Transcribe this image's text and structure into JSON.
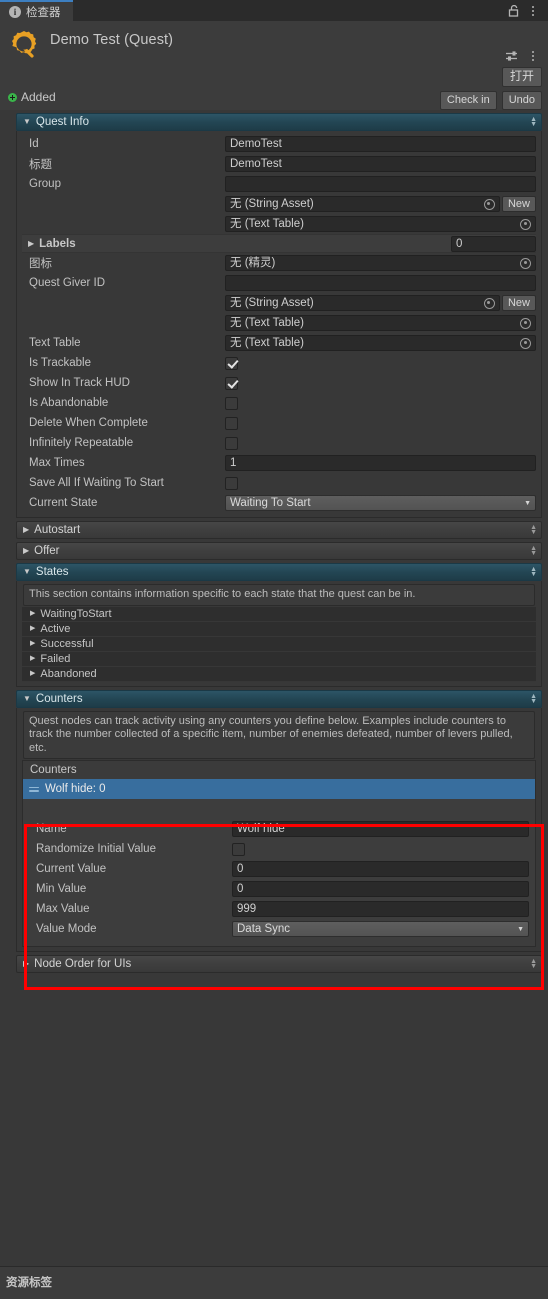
{
  "tab": {
    "label": "检查器",
    "icon": "info-icon"
  },
  "window_icons": {
    "lock": "lock-icon",
    "menu": "kebab-menu-icon",
    "preset": "preset-icon"
  },
  "object_header": {
    "icon": "quest-asset-icon",
    "title": "Demo Test (Quest)",
    "open_button": "打开",
    "status": "Added",
    "status_icon": "added-plus-icon",
    "check_in_button": "Check in",
    "undo_button": "Undo"
  },
  "quest_info": {
    "title": "Quest Info",
    "expanded": true,
    "rows": [
      {
        "label": "Id",
        "type": "text",
        "value": "DemoTest"
      },
      {
        "label": "标题",
        "type": "text",
        "value": "DemoTest"
      },
      {
        "label": "Group",
        "type": "text",
        "value": ""
      },
      {
        "label": "",
        "type": "object_new",
        "value": "无 (String Asset)",
        "new_label": "New"
      },
      {
        "label": "",
        "type": "object",
        "value": "无 (Text Table)"
      }
    ],
    "labels_array": {
      "label": "Labels",
      "size": "0",
      "expanded": false
    },
    "rows2": [
      {
        "label": "图标",
        "type": "object",
        "value": "无 (精灵)"
      },
      {
        "label": "Quest Giver ID",
        "type": "text",
        "value": ""
      },
      {
        "label": "",
        "type": "object_new",
        "value": "无 (String Asset)",
        "new_label": "New"
      },
      {
        "label": "",
        "type": "object",
        "value": "无 (Text Table)"
      },
      {
        "label": "Text Table",
        "type": "object",
        "value": "无 (Text Table)"
      },
      {
        "label": "Is Trackable",
        "type": "checkbox",
        "value": true
      },
      {
        "label": "Show In Track HUD",
        "type": "checkbox",
        "value": true
      },
      {
        "label": "Is Abandonable",
        "type": "checkbox",
        "value": false
      },
      {
        "label": "Delete When Complete",
        "type": "checkbox",
        "value": false
      },
      {
        "label": "Infinitely Repeatable",
        "type": "checkbox",
        "value": false
      },
      {
        "label": "Max Times",
        "type": "text",
        "value": "1"
      },
      {
        "label": "Save All If Waiting To Start",
        "type": "checkbox",
        "value": false
      },
      {
        "label": "Current State",
        "type": "dropdown",
        "value": "Waiting To Start"
      }
    ]
  },
  "autostart": {
    "title": "Autostart",
    "expanded": false
  },
  "offer": {
    "title": "Offer",
    "expanded": false
  },
  "states": {
    "title": "States",
    "expanded": true,
    "help": "This section contains information specific to each state that the quest can be in.",
    "items": [
      "WaitingToStart",
      "Active",
      "Successful",
      "Failed",
      "Abandoned"
    ]
  },
  "counters": {
    "title": "Counters",
    "expanded": true,
    "help": "Quest nodes can track activity using any counters you define below. Examples include counters to track the number collected of a specific item, number of enemies defeated, number of levers pulled, etc.",
    "list_header": "Counters",
    "list_items": [
      {
        "label": "Wolf hide: 0",
        "selected": true
      }
    ],
    "add_button": "+",
    "remove_button": "−",
    "detail": [
      {
        "label": "Name",
        "type": "text",
        "value": "Wolf hide"
      },
      {
        "label": "Randomize Initial Value",
        "type": "checkbox",
        "value": false
      },
      {
        "label": "Current Value",
        "type": "text",
        "value": "0"
      },
      {
        "label": "Min Value",
        "type": "text",
        "value": "0"
      },
      {
        "label": "Max Value",
        "type": "text",
        "value": "999"
      },
      {
        "label": "Value Mode",
        "type": "dropdown",
        "value": "Data Sync"
      }
    ]
  },
  "node_order": {
    "title": "Node Order for UIs",
    "expanded": false
  },
  "footer": {
    "label": "资源标签"
  },
  "colors": {
    "window_bg": "#383838",
    "header_bg": "#3c3c3c",
    "section_open": "#234654",
    "selection_blue": "#386e9e",
    "accent_tab": "#3d7fc1",
    "status_green": "#3ab54a",
    "highlight_red": "#ff0000",
    "quest_icon": "#e8a024"
  }
}
